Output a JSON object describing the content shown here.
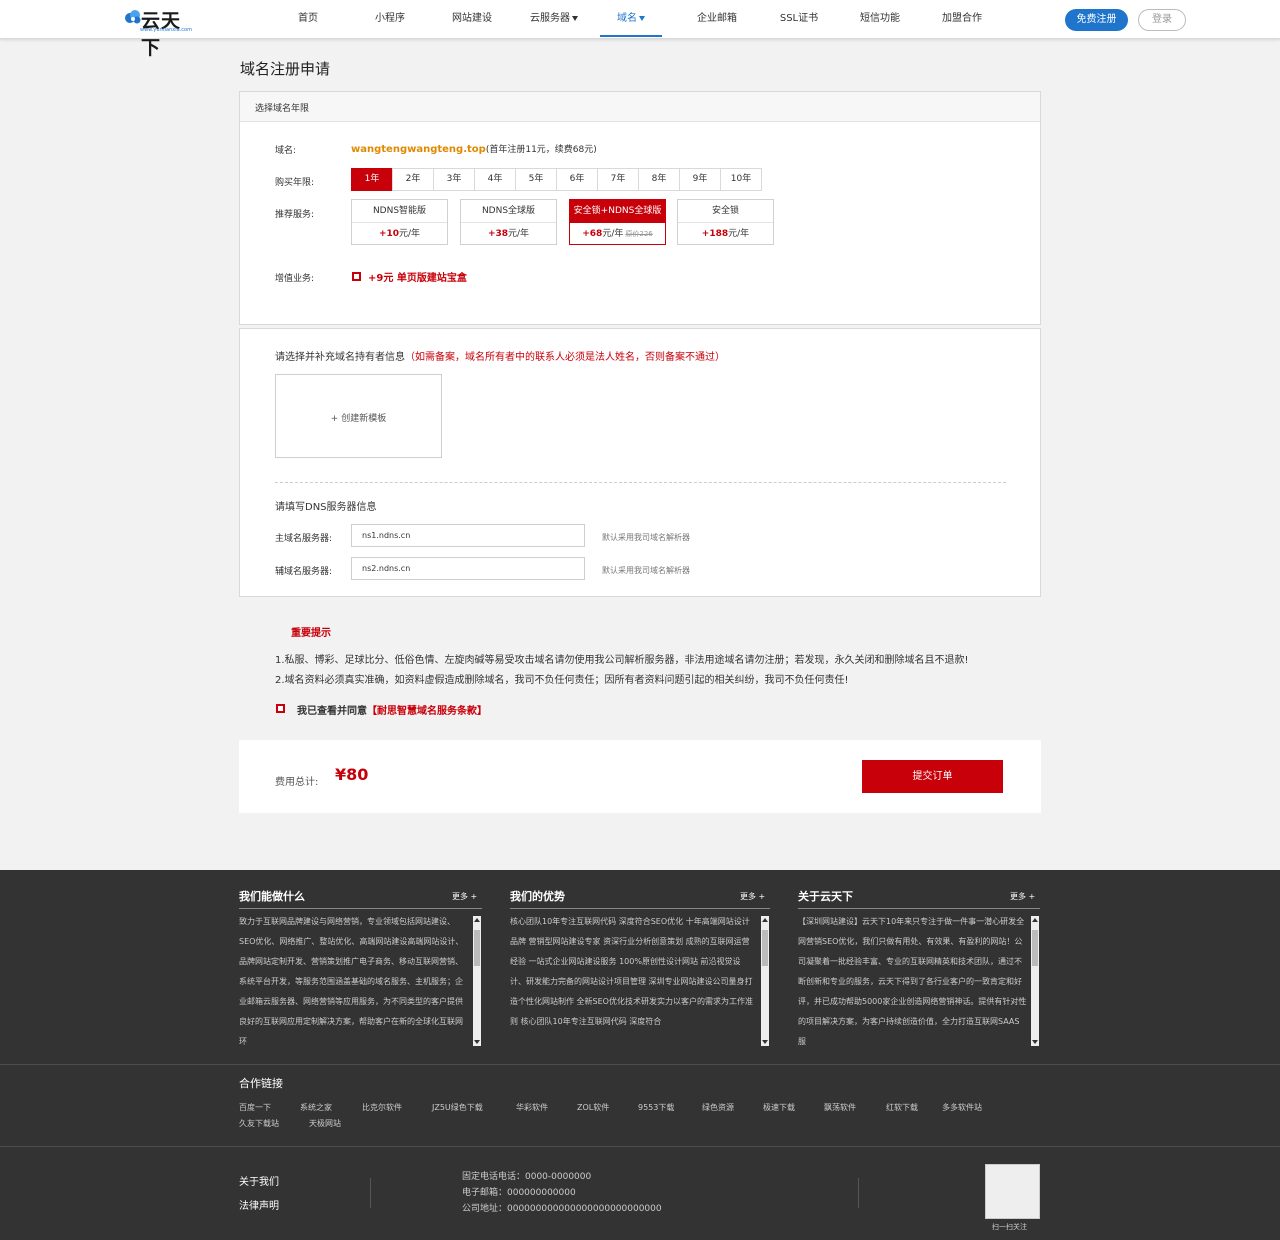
{
  "brand": {
    "name": "云天下",
    "url": "www.yuntianxia.com"
  },
  "nav": {
    "items": [
      "首页",
      "小程序",
      "网站建设",
      "云服务器",
      "域名",
      "企业邮箱",
      "SSL证书",
      "短信功能",
      "加盟合作"
    ],
    "register": "免费注册",
    "login": "登录"
  },
  "page": {
    "title": "域名注册申请"
  },
  "term_panel": {
    "header": "选择域名年限",
    "domain_label": "域名:",
    "domain": "wangtengwangteng.top",
    "domain_info": "(首年注册11元，续费68元)",
    "years_label": "购买年限:",
    "years": [
      "1年",
      "2年",
      "3年",
      "4年",
      "5年",
      "6年",
      "7年",
      "8年",
      "9年",
      "10年"
    ],
    "selected_year": "1年",
    "services_label": "推荐服务:",
    "services": [
      {
        "name": "NDNS智能版",
        "plus": "+",
        "amount": "10",
        "unit": "元/年",
        "orig": ""
      },
      {
        "name": "NDNS全球版",
        "plus": "+",
        "amount": "38",
        "unit": "元/年",
        "orig": ""
      },
      {
        "name": "安全锁+NDNS全球版",
        "plus": "+",
        "amount": "68",
        "unit": "元/年",
        "orig": "原价226"
      },
      {
        "name": "安全锁",
        "plus": "+",
        "amount": "188",
        "unit": "元/年",
        "orig": ""
      }
    ],
    "addon_label": "增值业务:",
    "addon": "+9元 单页版建站宝盒"
  },
  "holder_panel": {
    "title": "请选择并补充域名持有者信息",
    "warning": "（如需备案，域名所有者中的联系人必须是法人姓名，否则备案不通过）",
    "create_template": "+ 创建新模板",
    "dns_title": "请填写DNS服务器信息",
    "primary_label": "主域名服务器:",
    "primary_value": "ns1.ndns.cn",
    "secondary_label": "辅域名服务器:",
    "secondary_value": "ns2.ndns.cn",
    "hint": "默认采用我司域名解析器"
  },
  "notice": {
    "title": "重要提示",
    "line1": "1.私服、博彩、足球比分、低俗色情、左旋肉碱等易受攻击域名请勿使用我公司解析服务器，非法用途域名请勿注册；若发现，永久关闭和删除域名且不退款!",
    "line2": "2.域名资料必须真实准确，如资料虚假造成删除域名，我司不负任何责任；因所有者资料问题引起的相关纠纷，我司不负任何责任!",
    "agree_text": "我已查看并同意",
    "agree_link": "【耐思智慧域名服务条款】"
  },
  "total": {
    "label": "费用总计:",
    "value": "¥80",
    "submit": "提交订单"
  },
  "footer": {
    "more": "更多 +",
    "col1": {
      "title": "我们能做什么",
      "text": "致力于互联网品牌建设与网络营销，专业领域包括网站建设、SEO优化、网络推广、整站优化、高端网站建设高端网站设计、品牌网站定制开发、营销策划推广电子商务、移动互联网营销、系统平台开发，等服务范围涵盖基础的域名服务、主机服务；企业邮箱云服务器、网络营销等应用服务，为不同类型的客户提供良好的互联网应用定制解决方案，帮助客户在新的全球化互联网环"
    },
    "col2": {
      "title": "我们的优势",
      "text": "核心团队10年专注互联网代码 深度符合SEO优化 十年高端网站设计品牌 营销型网站建设专家 资深行业分析创意策划 成熟的互联网运营经验 一站式企业网站建设服务 100%原创性设计网站 前沿视觉设计、研发能力完备的网站设计项目管理 深圳专业网站建设公司量身打造个性化网站制作 全新SEO优化技术研发实力以客户的需求为工作准则 核心团队10年专注互联网代码 深度符合"
    },
    "col3": {
      "title": "关于云天下",
      "text": "【深圳网站建设】云天下10年来只专注于做一件事一潜心研发全网营销SEO优化，我们只做有用处、有效果、有盈利的网站！公司凝聚着一批经验丰富、专业的互联网精英和技术团队，通过不断创新和专业的服务，云天下得到了各行业客户的一致肯定和好评，并已成功帮助5000家企业创造网络营销神话。提供有针对性的项目解决方案，为客户持续创造价值，全力打造互联网SAAS服"
    },
    "links_title": "合作链接",
    "links": [
      "百度一下",
      "系统之家",
      "比克尔软件",
      "JZ5U绿色下载",
      "华彩软件",
      "ZOL软件",
      "9553下载",
      "绿色资源",
      "极速下载",
      "飘荡软件",
      "红软下载",
      "多多软件站",
      "久友下载站",
      "天极网站"
    ],
    "about": "关于我们",
    "legal": "法律声明",
    "phone": "固定电话电话：0000-0000000",
    "email": "电子邮箱：000000000000",
    "address": "公司地址：000000000000000000000000000",
    "qr_label": "扫一扫关注"
  }
}
